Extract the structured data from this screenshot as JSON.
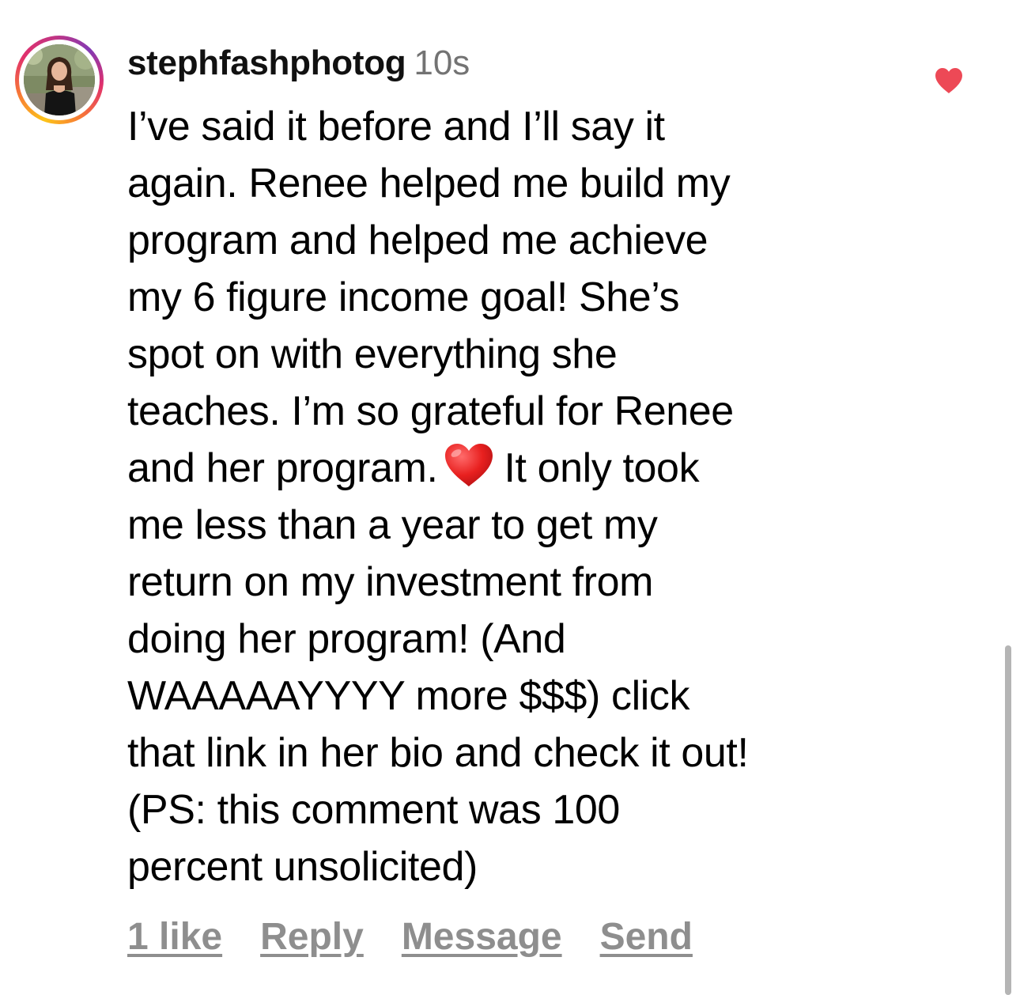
{
  "comment": {
    "username": "stephfashphotog",
    "timestamp": "10s",
    "body_lines": [
      "I’ve said it before and I’ll say it",
      "again. Renee helped me build my",
      "program and helped me achieve",
      "my 6 figure income goal! She’s",
      "spot on with everything she",
      "teaches. I’m so grateful for Renee"
    ],
    "line_with_emoji": {
      "before": "and her program.",
      "emoji": "red-heart-emoji",
      "after": "It only took"
    },
    "body_lines_after": [
      "me less than a year to get my",
      "return on my investment from",
      "doing her program! (And",
      "WAAAAAYYYY more $$$) click",
      "that link in her bio and check it out!",
      "(PS:  this comment was 100",
      "percent unsolicited)"
    ],
    "liked": true,
    "like_icon": "heart-icon",
    "like_color": "#ed4956"
  },
  "actions": {
    "likes": "1 like",
    "reply": "Reply",
    "message": "Message",
    "send": "Send"
  },
  "colors": {
    "text": "#000000",
    "secondary": "#737373",
    "action": "#8e8e8e",
    "ring_start": "#fcc419",
    "ring_end": "#c13584"
  }
}
